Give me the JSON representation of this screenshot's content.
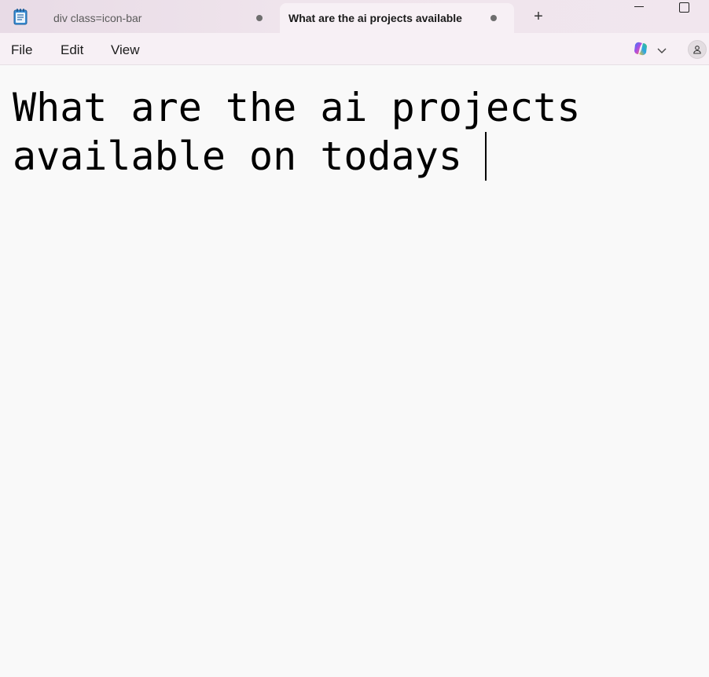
{
  "tabs": [
    {
      "label": "div class=icon-bar",
      "active": false,
      "unsaved": true
    },
    {
      "label": "What are the ai projects available",
      "active": true,
      "unsaved": true
    }
  ],
  "new_tab_label": "+",
  "menu": {
    "file": "File",
    "edit": "Edit",
    "view": "View"
  },
  "editor": {
    "content": "What are the ai projects\navailable on todays "
  },
  "icons": {
    "app": "notepad-icon",
    "copilot": "copilot-icon",
    "profile": "person-icon"
  },
  "colors": {
    "titlebar": "#efe4ec",
    "active_tab": "#f7f0f5",
    "editor_bg": "#f9f9f9",
    "text": "#000000"
  }
}
